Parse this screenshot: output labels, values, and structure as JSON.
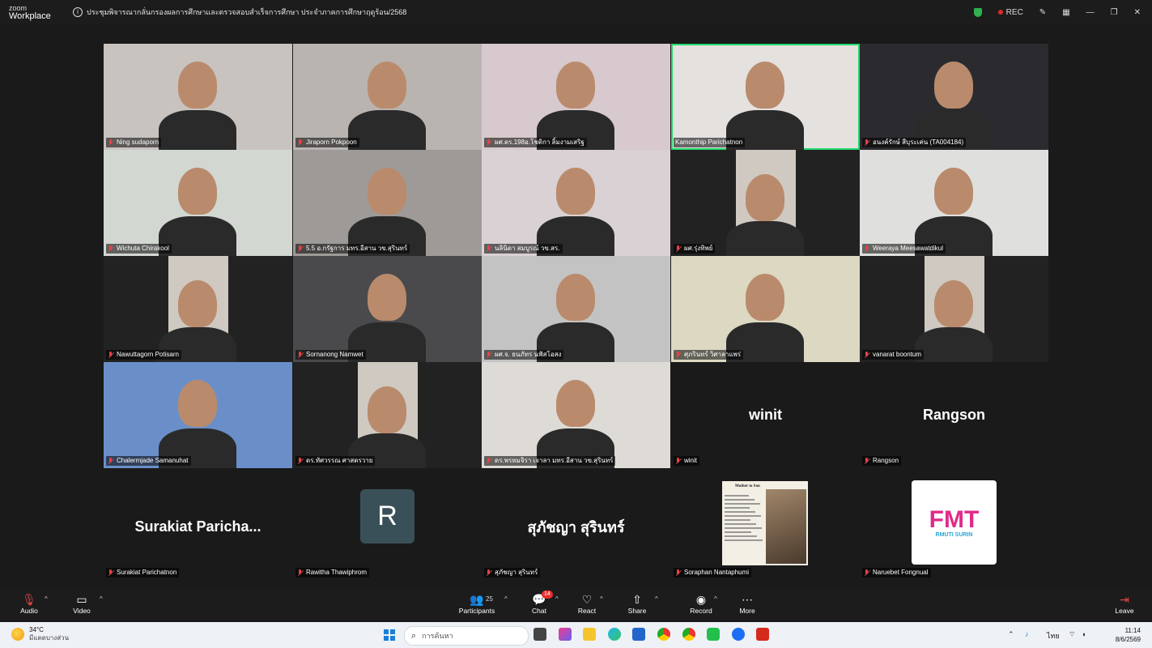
{
  "titlebar": {
    "app_small": "zoom",
    "app_name": "Workplace",
    "meeting_title": "ประชุมพิจารณากลั่นกรองผลการศึกษาและตรวจสอบสำเร็จการศึกษา ประจำภาคการศึกษาฤดูร้อน/2568",
    "rec_label": "REC"
  },
  "participants": [
    {
      "name": "Ning sudaporn",
      "muted": true,
      "active": false,
      "bg": "#c9c3c0"
    },
    {
      "name": "Jiraporn Pokpoon",
      "muted": true,
      "active": false,
      "bg": "#b9b4b0"
    },
    {
      "name": "ผศ.ดร.198อ.โชติกา ลิ้มงามเสริฐ",
      "muted": true,
      "active": false,
      "bg": "#d7c9cd"
    },
    {
      "name": "Kamonthip Parichatnon",
      "muted": false,
      "active": true,
      "bg": "#e4e1df"
    },
    {
      "name": "อนงค์รักษ์ สีบุระเค่น (TA004184)",
      "muted": true,
      "active": false,
      "bg": "#2b2b2f"
    },
    {
      "name": "Wichuta Chirakool",
      "muted": true,
      "active": false,
      "bg": "#d2d7d2"
    },
    {
      "name": "5.5 อ.กรัฐการ มทร.อีสาน วข.สุรินทร์",
      "muted": true,
      "active": false,
      "bg": "#9e9a97"
    },
    {
      "name": "นลินิดา สมบูรณ์ วข.สร.",
      "muted": true,
      "active": false,
      "bg": "#d9d1d3"
    },
    {
      "name": "ผศ.รุ่งทิพย์",
      "muted": true,
      "active": false,
      "bg": "#222222"
    },
    {
      "name": "Weeraya Meesawatdikul",
      "muted": true,
      "active": false,
      "bg": "#dfe0dd"
    },
    {
      "name": "Nawuttagorn Potisarn",
      "muted": true,
      "active": false,
      "bg": "#222222"
    },
    {
      "name": "Sornanong Namwet",
      "muted": true,
      "active": false,
      "bg": "#4a4a4c"
    },
    {
      "name": "ผศ.จ. ธนภัทร นฟัสโอสง",
      "muted": true,
      "active": false,
      "bg": "#c3c3c3"
    },
    {
      "name": "ศุภรินทร์ วิศาลาแพร่",
      "muted": true,
      "active": false,
      "bg": "#dcd8c2"
    },
    {
      "name": "vanarat boontum",
      "muted": true,
      "active": false,
      "bg": "#222222"
    },
    {
      "name": "Chalermjade Samanuhat",
      "muted": true,
      "active": false,
      "bg": "#6a8fc8"
    },
    {
      "name": "ดร.ทัศวรรณ ศาสตรวาย",
      "muted": true,
      "active": false,
      "bg": "#222222"
    },
    {
      "name": "ดร.พรหมจิรา เจาลา มทร.อีสาน วข.สุรินทร์",
      "muted": true,
      "active": false,
      "bg": "#dedad6"
    },
    {
      "name": "winit",
      "muted": true,
      "active": false,
      "bg": "#1a1a1a",
      "display": "winit"
    },
    {
      "name": "Rangson",
      "muted": true,
      "active": false,
      "bg": "#1a1a1a",
      "display": "Rangson"
    },
    {
      "name": "Surakiat Parichatnon",
      "muted": true,
      "active": false,
      "bg": "#1a1a1a",
      "display": "Surakiat  Paricha..."
    },
    {
      "name": "Rawitha Thawiphrom",
      "muted": true,
      "active": false,
      "bg": "#1a1a1a",
      "avatar_letter": "R"
    },
    {
      "name": "สุภัชญา สุรินทร์",
      "muted": true,
      "active": false,
      "bg": "#1a1a1a",
      "display": "สุภัชญา สุรินทร์"
    },
    {
      "name": "Soraphan Nantaphumi",
      "muted": true,
      "active": false,
      "bg": "#1a1a1a",
      "poem_title": "Mother to Son"
    },
    {
      "name": "Naruebet Fongnual",
      "muted": true,
      "active": false,
      "bg": "#1a1a1a",
      "logo_text": "FMT",
      "logo_sub": "RMUTI SURIN"
    }
  ],
  "toolbar": {
    "audio": "Audio",
    "video": "Video",
    "participants": "Participants",
    "participants_count": "25",
    "chat": "Chat",
    "chat_badge": "14",
    "react": "React",
    "share": "Share",
    "record": "Record",
    "more": "More",
    "leave": "Leave"
  },
  "taskbar": {
    "temperature": "34°C",
    "weather_desc": "มีแดดบางส่วน",
    "search_placeholder": "การค้นหา",
    "language": "ไทย",
    "time": "11:14",
    "date": "8/6/2569"
  }
}
